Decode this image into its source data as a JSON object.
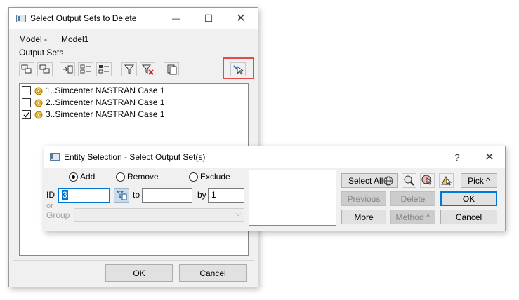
{
  "main_dialog": {
    "title": "Select Output Sets to Delete",
    "model_label": "Model -",
    "model_value": "Model1",
    "output_sets_label": "Output Sets",
    "items": [
      {
        "label": "1..Simcenter NASTRAN Case 1",
        "checked": false
      },
      {
        "label": "2..Simcenter NASTRAN Case 1",
        "checked": false
      },
      {
        "label": "3..Simcenter NASTRAN Case 1",
        "checked": true
      }
    ],
    "ok_label": "OK",
    "cancel_label": "Cancel"
  },
  "entity_dialog": {
    "title": "Entity Selection - Select Output Set(s)",
    "help_glyph": "?",
    "close_glyph": "✕",
    "radio_add": "Add",
    "radio_remove": "Remove",
    "radio_exclude": "Exclude",
    "selected_mode": "Add",
    "id_label": "ID",
    "id_value": "3",
    "to_label": "to",
    "to_value": "",
    "by_label": "by",
    "by_value": "1",
    "or_label": "or",
    "group_label": "Group",
    "select_all_label": "Select All",
    "pick_label": "Pick ^",
    "previous_label": "Previous",
    "delete_label": "Delete",
    "ok_label": "OK",
    "more_label": "More",
    "method_label": "Method ^",
    "cancel_label": "Cancel"
  },
  "titlebar_glyphs": {
    "minimize": "—",
    "maximize": "☐",
    "close": "✕"
  },
  "colors": {
    "highlight_box": "#e84a4a",
    "accent": "#0078d7",
    "gear": "#d9a400"
  }
}
